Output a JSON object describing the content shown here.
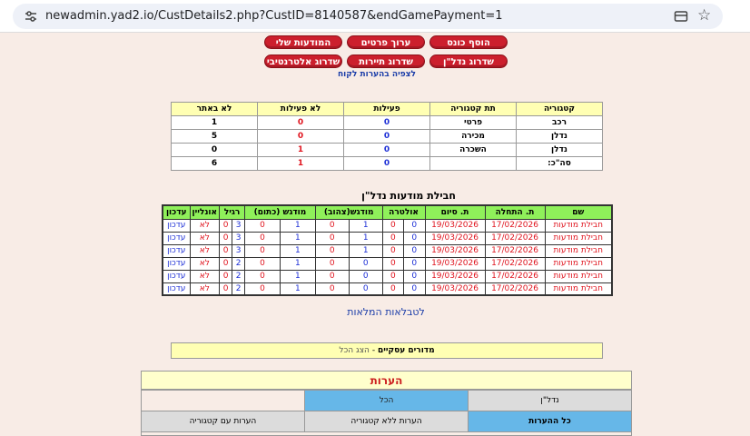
{
  "browser": {
    "url": "newadmin.yad2.io/CustDetails2.php?CustID=8140587&endGamePayment=1"
  },
  "buttons": {
    "add_balance": "הוסף כונס",
    "edit_details": "ערוך פרטים",
    "my_ads": "המודעות שלי",
    "upgrade_realestate": "שדרוג נדל\"ן",
    "upgrade_tourism": "שדרוג תיירות",
    "upgrade_alternative": "שדרוג אלטרנטיבי",
    "view_notes": "לצפיה בהערות לקוח"
  },
  "category_table": {
    "headers": [
      "קטגוריה",
      "תת קטגוריה",
      "פעילות",
      "לא פעילות",
      "לא באתר"
    ],
    "rows": [
      {
        "category": "רכב",
        "sub": "פרטי",
        "active": "0",
        "inactive": "0",
        "not_on_site": "1"
      },
      {
        "category": "נדלן",
        "sub": "מכירה",
        "active": "0",
        "inactive": "0",
        "not_on_site": "5"
      },
      {
        "category": "נדלן",
        "sub": "השכרה",
        "active": "0",
        "inactive": "1",
        "not_on_site": "0"
      },
      {
        "category": "סה\"כ:",
        "sub": "",
        "active": "0",
        "inactive": "1",
        "not_on_site": "6"
      }
    ]
  },
  "packages": {
    "title": "חבילת מודעות נדל\"ן",
    "headers": [
      "שם",
      "ת. התחלה",
      "ת. סיום",
      "אולטרה",
      "מודגש(צהוב)",
      "מודגש (כתום)",
      "רגיל",
      "אונליין",
      "עדכון"
    ],
    "rows": [
      {
        "name": "חבילת מודעות",
        "start": "17/02/2026",
        "end": "19/03/2026",
        "ultra": "0",
        "ultra2": "0",
        "yellow": "1",
        "yellow2": "0",
        "orange": "1",
        "orange2": "0",
        "regular": "3",
        "regular2": "0",
        "online": "לא",
        "update": "עדכון"
      },
      {
        "name": "חבילת מודעות",
        "start": "17/02/2026",
        "end": "19/03/2026",
        "ultra": "0",
        "ultra2": "0",
        "yellow": "1",
        "yellow2": "0",
        "orange": "1",
        "orange2": "0",
        "regular": "3",
        "regular2": "0",
        "online": "לא",
        "update": "עדכון"
      },
      {
        "name": "חבילת מודעות",
        "start": "17/02/2026",
        "end": "19/03/2026",
        "ultra": "0",
        "ultra2": "0",
        "yellow": "1",
        "yellow2": "0",
        "orange": "1",
        "orange2": "0",
        "regular": "3",
        "regular2": "0",
        "online": "לא",
        "update": "עדכון"
      },
      {
        "name": "חבילת מודעות",
        "start": "17/02/2026",
        "end": "19/03/2026",
        "ultra": "0",
        "ultra2": "0",
        "yellow": "0",
        "yellow2": "0",
        "orange": "1",
        "orange2": "0",
        "regular": "2",
        "regular2": "0",
        "online": "לא",
        "update": "עדכון"
      },
      {
        "name": "חבילת מודעות",
        "start": "17/02/2026",
        "end": "19/03/2026",
        "ultra": "0",
        "ultra2": "0",
        "yellow": "0",
        "yellow2": "0",
        "orange": "1",
        "orange2": "0",
        "regular": "2",
        "regular2": "0",
        "online": "לא",
        "update": "עדכון"
      },
      {
        "name": "חבילת מודעות",
        "start": "17/02/2026",
        "end": "19/03/2026",
        "ultra": "0",
        "ultra2": "0",
        "yellow": "0",
        "yellow2": "0",
        "orange": "1",
        "orange2": "0",
        "regular": "2",
        "regular2": "0",
        "online": "לא",
        "update": "עדכון"
      }
    ]
  },
  "tables_link": "לטבלאות המלאות",
  "business": {
    "label": "מדורים עסקיים",
    "separator": "-",
    "show_all": "הצג הכל"
  },
  "notes": {
    "title": "הערות",
    "filter_realestate": "נדל\"ן",
    "filter_all": "הכל",
    "tab_all_notes": "כל ההערות",
    "tab_no_category": "הערות ללא קטגוריה",
    "tab_with_category": "הערות עם קטגוריה"
  }
}
